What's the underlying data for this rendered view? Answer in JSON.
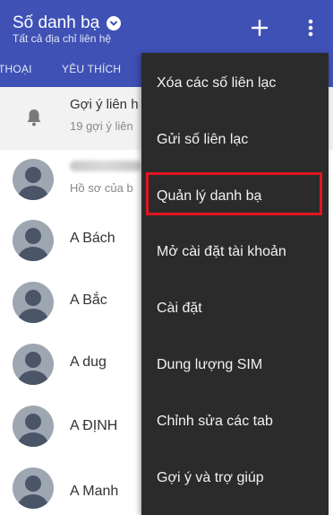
{
  "header": {
    "title": "Số danh bạ",
    "subtitle": "Tất cả địa chỉ liên hệ",
    "add_icon": "plus-icon",
    "more_icon": "more-vert-icon",
    "background": "#3f51b5"
  },
  "tabs": [
    {
      "label": "THOẠI"
    },
    {
      "label": "YÊU THÍCH"
    }
  ],
  "suggestions": {
    "title": "Gợi ý liên h",
    "subtitle": "19 gợi ý liên",
    "icon": "bell-icon"
  },
  "profile": {
    "subtitle": "Hồ sơ của b"
  },
  "contacts": [
    {
      "name": "A Bách"
    },
    {
      "name": "A Bắc"
    },
    {
      "name": "A dug"
    },
    {
      "name": "A ĐỊNH"
    },
    {
      "name": "A Manh"
    }
  ],
  "menu": {
    "items": [
      {
        "label": "Xóa các số liên lạc"
      },
      {
        "label": "Gửi số liên lạc"
      },
      {
        "label": "Quản lý danh bạ"
      },
      {
        "label": "Mở cài đặt tài khoản"
      },
      {
        "label": "Cài đặt"
      },
      {
        "label": "Dung lượng SIM"
      },
      {
        "label": "Chỉnh sửa các tab"
      },
      {
        "label": "Gợi ý và trợ giúp"
      }
    ],
    "highlighted_index": 2,
    "background": "#2b2b2b",
    "highlight_color": "#e0151f"
  }
}
